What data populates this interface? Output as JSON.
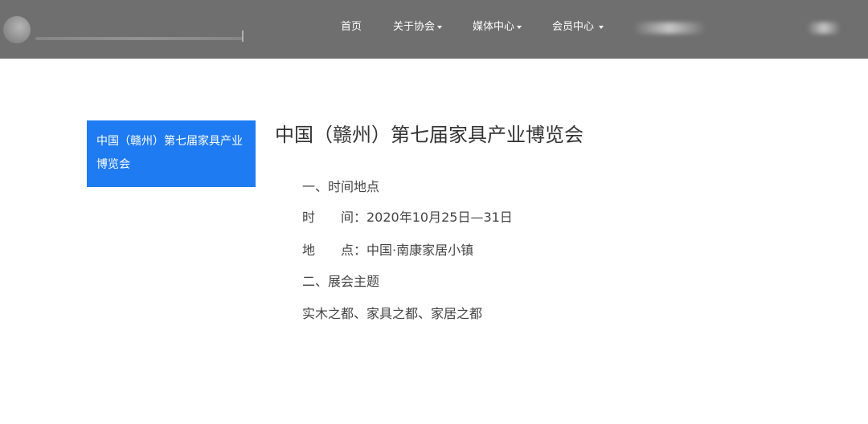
{
  "nav": {
    "items": [
      {
        "label": "首页",
        "has_dropdown": false
      },
      {
        "label": "关于协会",
        "has_dropdown": true
      },
      {
        "label": "媒体中心",
        "has_dropdown": true
      },
      {
        "label": "会员中心",
        "has_dropdown": true
      }
    ]
  },
  "sidebar": {
    "active_item": "中国（赣州）第七届家具产业博览会"
  },
  "article": {
    "title": "中国（赣州）第七届家具产业博览会",
    "lines": [
      "一、时间地点",
      "时　　间：2020年10月25日—31日",
      "地　　点：中国·南康家居小镇",
      "二、展会主题",
      "实木之都、家具之都、家居之都"
    ]
  },
  "colors": {
    "nav_bg": "#6f6f6f",
    "sidebar_active_bg": "#1f7bf2",
    "title_text": "#333333"
  }
}
